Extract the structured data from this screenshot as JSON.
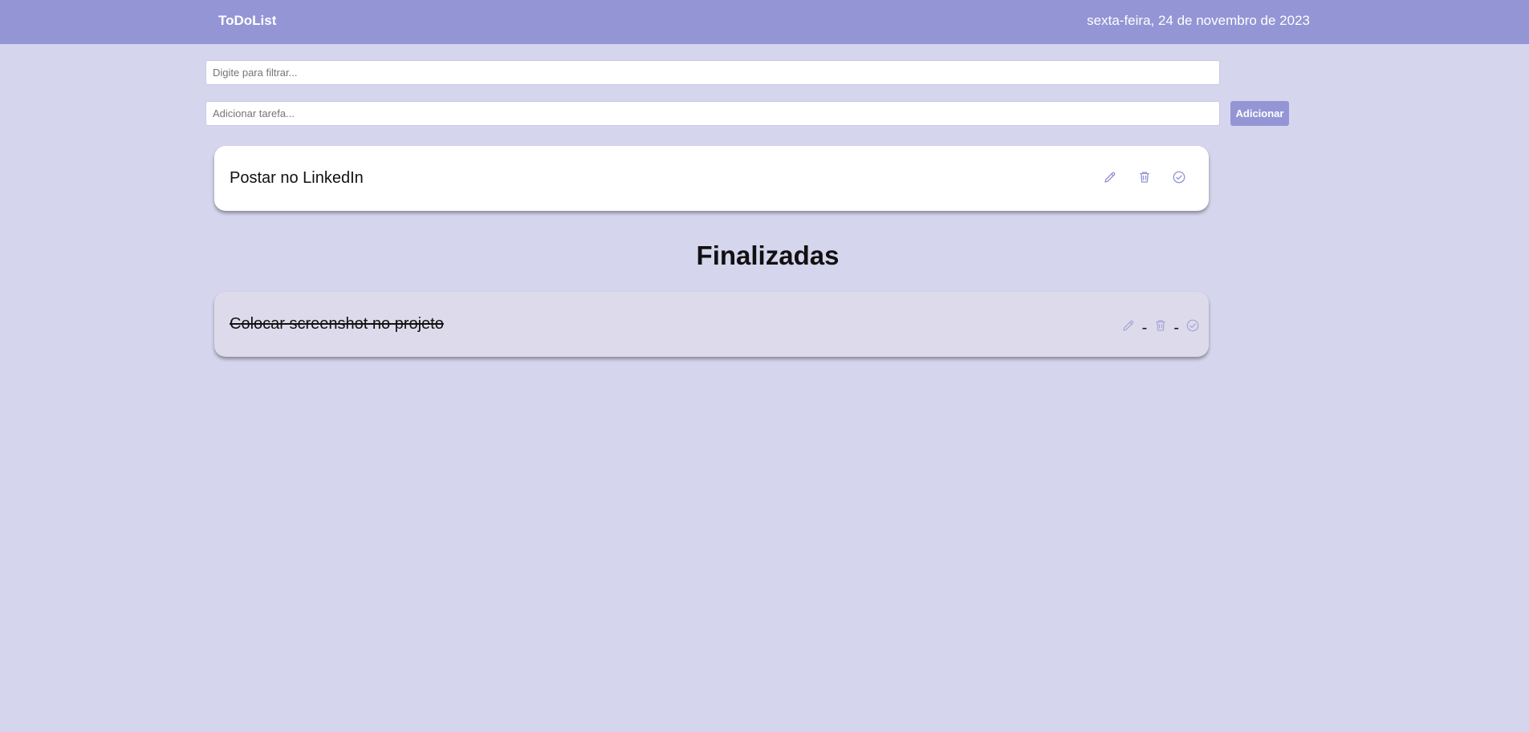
{
  "header": {
    "brand": "ToDoList",
    "date": "sexta-feira, 24 de novembro de 2023"
  },
  "filter": {
    "placeholder": "Digite para filtrar...",
    "value": ""
  },
  "add_task": {
    "placeholder": "Adicionar tarefa...",
    "value": "",
    "button_label": "Adicionar"
  },
  "pending_tasks": [
    {
      "text": "Postar no LinkedIn",
      "icons": [
        "pencil-icon",
        "trash-icon",
        "check-circle-icon"
      ]
    }
  ],
  "finished_section": {
    "title": "Finalizadas",
    "separator": "-"
  },
  "finished_tasks": [
    {
      "text": "Colocar screenshot no projeto",
      "icons": [
        "pencil-icon",
        "trash-icon",
        "check-circle-icon"
      ]
    }
  ],
  "colors": {
    "background": "#d6d5ee",
    "accent": "#9495d5",
    "card_pending": "#ffffff",
    "card_done": "#dddbeb",
    "icon": "#9495d5"
  }
}
